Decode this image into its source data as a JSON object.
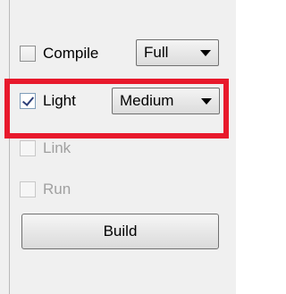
{
  "options": {
    "compile": {
      "label": "Compile",
      "checked": false,
      "enabled": true,
      "mode": "Full"
    },
    "light": {
      "label": "Light",
      "checked": true,
      "enabled": true,
      "mode": "Medium"
    },
    "link": {
      "label": "Link",
      "checked": false,
      "enabled": false
    },
    "run": {
      "label": "Run",
      "checked": false,
      "enabled": false
    }
  },
  "build_button": {
    "label": "Build"
  },
  "colors": {
    "highlight": "#e8192c",
    "disabled_text": "#a0a0a0",
    "panel_bg": "#f0f0f0"
  }
}
